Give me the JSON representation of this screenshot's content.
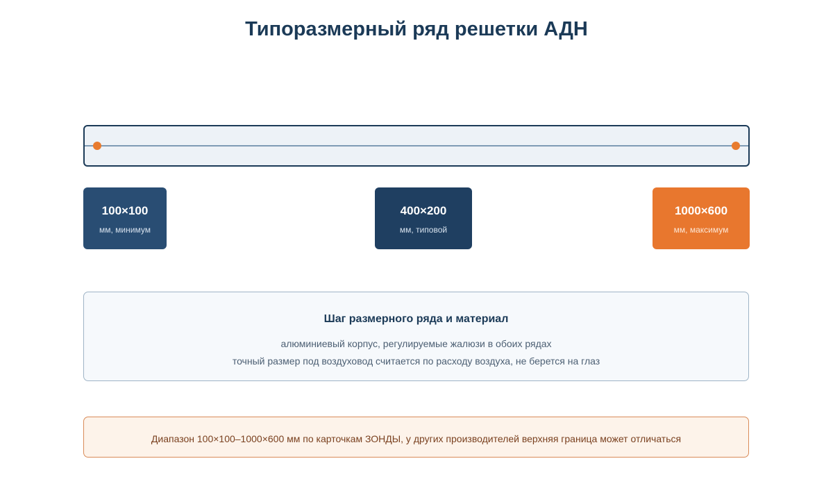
{
  "title": "Типоразмерный ряд решетки АДН",
  "sizes": [
    {
      "value": "100×100",
      "label": "мм, минимум"
    },
    {
      "value": "400×200",
      "label": "мм, типовой"
    },
    {
      "value": "1000×600",
      "label": "мм, максимум"
    }
  ],
  "info": {
    "heading": "Шаг размерного ряда и материал",
    "lines": [
      "алюминиевый корпус, регулируемые жалюзи в обоих рядах",
      "точный размер под воздуховод считается по расходу воздуха, не берется на глаз"
    ]
  },
  "note": "Диапазон 100×100–1000×600 мм по карточкам ЗОНДЫ, у других производителей верхняя граница может отличаться",
  "colors": {
    "primary": "#1b3a57",
    "accent": "#e8772e",
    "card_min": "#294d73",
    "card_typical": "#1f3f61"
  }
}
